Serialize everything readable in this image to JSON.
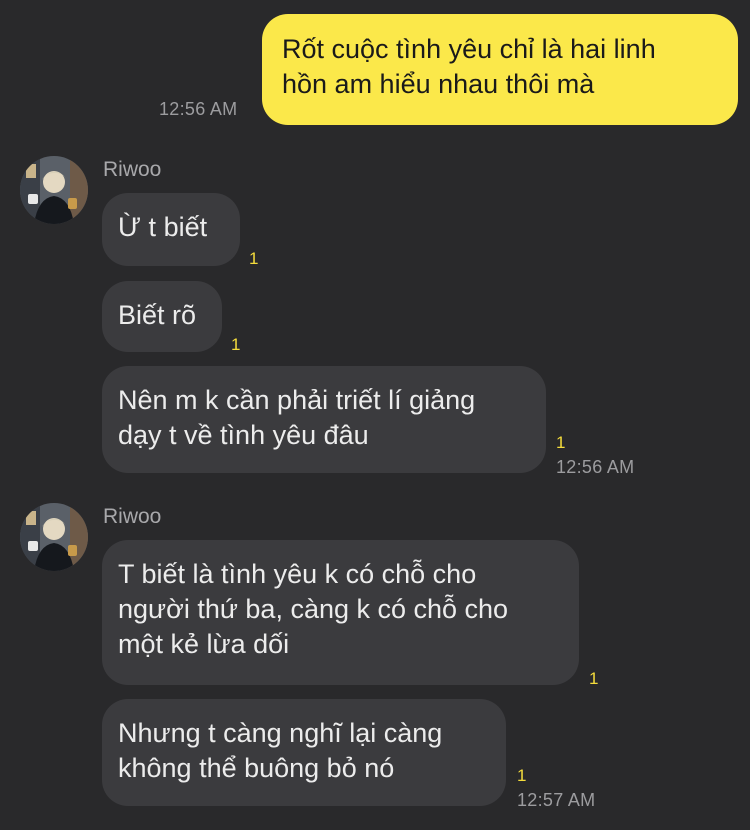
{
  "messages": {
    "out1": {
      "text": "Rốt cuộc tình yêu chỉ là hai linh\nhồn am hiểu nhau thôi mà",
      "time": "12:56 AM"
    },
    "group1": {
      "sender": "Riwoo",
      "m1": {
        "text": "Ừ t biết",
        "unread": "1"
      },
      "m2": {
        "text": "Biết rõ",
        "unread": "1"
      },
      "m3": {
        "text": "Nên m k cần phải triết lí giảng\ndạy t về tình yêu đâu",
        "unread": "1",
        "time": "12:56 AM"
      }
    },
    "group2": {
      "sender": "Riwoo",
      "m1": {
        "text": "T biết là tình yêu k có chỗ cho\nngười thứ ba, càng k có chỗ cho\nmột kẻ lừa dối",
        "unread": "1"
      },
      "m2": {
        "text": "Nhưng t càng nghĩ lại càng\nkhông thể buông bỏ nó",
        "unread": "1",
        "time": "12:57 AM"
      }
    }
  },
  "colors": {
    "background": "#29292b",
    "incoming_bubble": "#3b3b3e",
    "outgoing_bubble": "#fbe84a",
    "unread_count": "#f4dc3c"
  }
}
